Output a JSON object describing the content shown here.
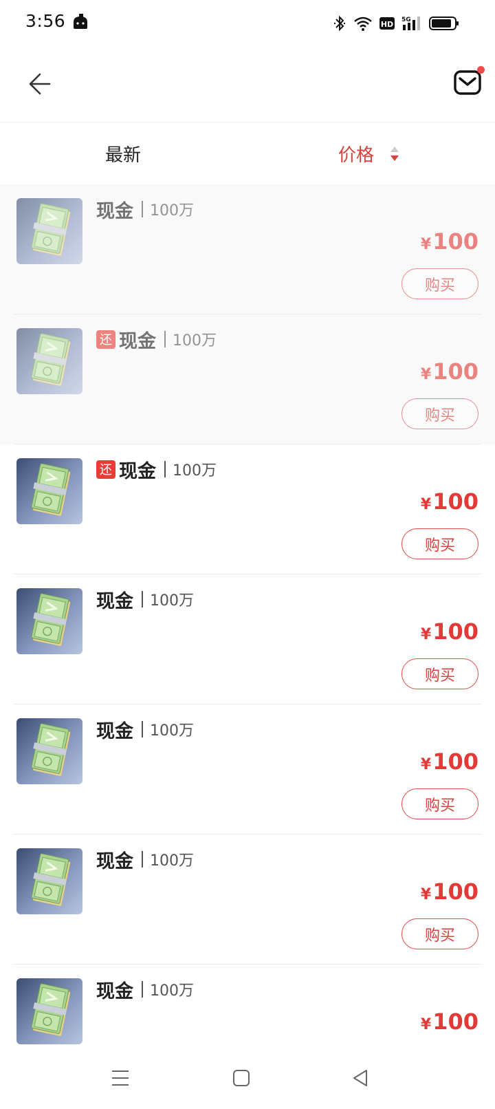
{
  "status_bar": {
    "time": "3:56",
    "icons": [
      "app-icon",
      "bluetooth-icon",
      "wifi-icon",
      "hd-icon",
      "signal-5g-icon",
      "battery-icon"
    ],
    "hd_label": "HD",
    "network_label": "5G"
  },
  "header": {
    "back_icon": "arrow-left-icon",
    "mail_icon": "mail-icon",
    "has_notification": true
  },
  "sort": {
    "latest_label": "最新",
    "price_label": "价格",
    "price_active": true,
    "sort_icon": "sort-arrows-icon"
  },
  "colors": {
    "accent": "#e23a37",
    "text": "#222222",
    "muted": "#555555",
    "divider": "#ececec"
  },
  "items": [
    {
      "tag": "",
      "name": "现金",
      "amount": "100万",
      "currency": "¥",
      "price": "100",
      "button": "购买",
      "faded": true
    },
    {
      "tag": "还",
      "name": "现金",
      "amount": "100万",
      "currency": "¥",
      "price": "100",
      "button": "购买",
      "faded": true
    },
    {
      "tag": "还",
      "name": "现金",
      "amount": "100万",
      "currency": "¥",
      "price": "100",
      "button": "购买",
      "faded": false
    },
    {
      "tag": "",
      "name": "现金",
      "amount": "100万",
      "currency": "¥",
      "price": "100",
      "button": "购买",
      "faded": false
    },
    {
      "tag": "",
      "name": "现金",
      "amount": "100万",
      "currency": "¥",
      "price": "100",
      "button": "购买",
      "faded": false
    },
    {
      "tag": "",
      "name": "现金",
      "amount": "100万",
      "currency": "¥",
      "price": "100",
      "button": "购买",
      "faded": false
    },
    {
      "tag": "",
      "name": "现金",
      "amount": "100万",
      "currency": "¥",
      "price": "100",
      "button": "",
      "faded": false
    }
  ],
  "nav": {
    "icons": [
      "menu-icon",
      "home-square-icon",
      "back-triangle-icon"
    ]
  }
}
